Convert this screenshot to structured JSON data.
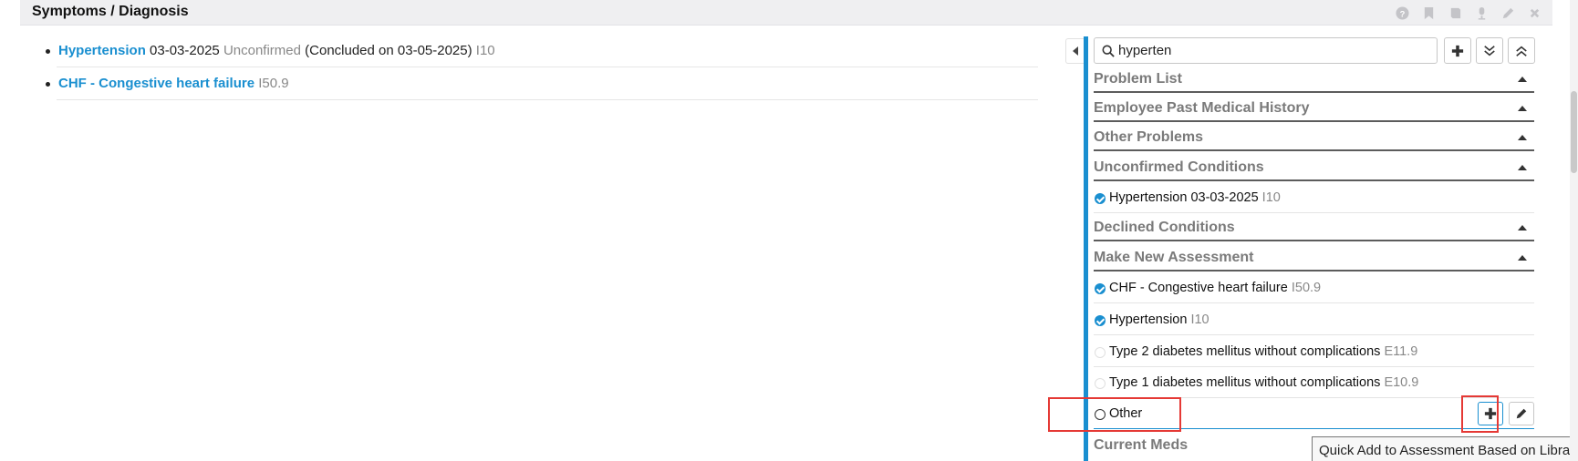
{
  "header": {
    "title": "Symptoms / Diagnosis",
    "icons": [
      "help-icon",
      "bookmark-icon",
      "book-icon",
      "microphone-icon",
      "pencil-icon",
      "close-icon"
    ]
  },
  "diagnoses": [
    {
      "name": "Hypertension",
      "date": "03-03-2025",
      "status": "Unconfirmed",
      "note": "(Concluded on 03-05-2025)",
      "code": "I10"
    },
    {
      "name": "CHF - Congestive heart failure",
      "code": "I50.9"
    }
  ],
  "search": {
    "value": "hyperten"
  },
  "sections": {
    "problem_list": "Problem List",
    "employee_pmh": "Employee Past Medical History",
    "other_problems": "Other Problems",
    "unconfirmed": "Unconfirmed Conditions",
    "declined": "Declined Conditions",
    "make_new": "Make New Assessment",
    "current_meds": "Current Meds"
  },
  "unconfirmed_items": [
    {
      "label": "Hypertension 03-03-2025",
      "code": "I10",
      "checked": true
    }
  ],
  "new_assessment_items": [
    {
      "label": "CHF - Congestive heart failure",
      "code": "I50.9",
      "checked": true
    },
    {
      "label": "Hypertension",
      "code": "I10",
      "checked": true
    },
    {
      "label": "Type 2 diabetes mellitus without complications",
      "code": "E11.9",
      "checked": false
    },
    {
      "label": "Type 1 diabetes mellitus without complications",
      "code": "E10.9",
      "checked": false
    }
  ],
  "other_row": {
    "label": "Other"
  },
  "tooltip": "Quick Add to Assessment Based on Library",
  "colors": {
    "accent": "#1a8fd0",
    "highlight": "#e53935"
  }
}
